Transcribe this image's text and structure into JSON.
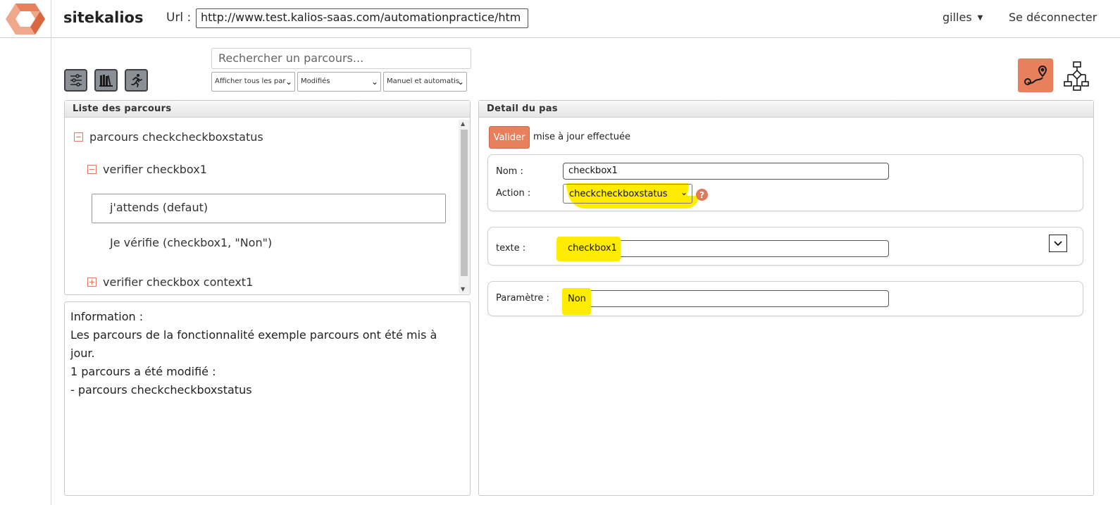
{
  "header": {
    "brand": "sitekalios",
    "url_label": "Url :",
    "url_value": "http://www.test.kalios-saas.com/automationpractice/htm",
    "user": "gilles",
    "logout": "Se déconnecter"
  },
  "toolbar": {
    "search_placeholder": "Rechercher un parcours...",
    "filter1": "Afficher tous les par",
    "filter2": "Modifiés",
    "filter3": "Manuel et automatis"
  },
  "list_panel": {
    "title": "Liste des parcours",
    "tree": [
      {
        "label": "parcours checkcheckboxstatus",
        "state": "expanded"
      },
      {
        "label": "verifier checkbox1",
        "state": "expanded"
      },
      {
        "label": "j'attends (defaut)",
        "state": "selected"
      },
      {
        "label": "Je vérifie (checkbox1, \"Non\")",
        "state": "leaf"
      },
      {
        "label": "verifier checkbox context1",
        "state": "collapsed"
      }
    ]
  },
  "info_panel": {
    "lines": [
      "Information :",
      "Les parcours de la fonctionnalité exemple parcours ont été mis à",
      "jour.",
      "1 parcours a été modifié :",
      "- parcours checkcheckboxstatus"
    ]
  },
  "detail_panel": {
    "title": "Detail du pas",
    "validate_label": "Valider",
    "status": "mise à jour effectuée",
    "nom_label": "Nom :",
    "nom_value": "checkbox1",
    "action_label": "Action :",
    "action_value": "checkcheckboxstatus",
    "help": "?",
    "texte_label": "texte :",
    "texte_value": "checkbox1",
    "param_label": "Paramètre :",
    "param_value": "Non"
  },
  "colors": {
    "accent": "#e8805e",
    "highlight": "#ffec00",
    "tool_button": "#8b8f96"
  },
  "icons": [
    "logo-icon",
    "settings-sliders-icon",
    "library-icon",
    "runner-icon",
    "route-map-icon",
    "flowchart-icon",
    "chevron-down-icon"
  ]
}
